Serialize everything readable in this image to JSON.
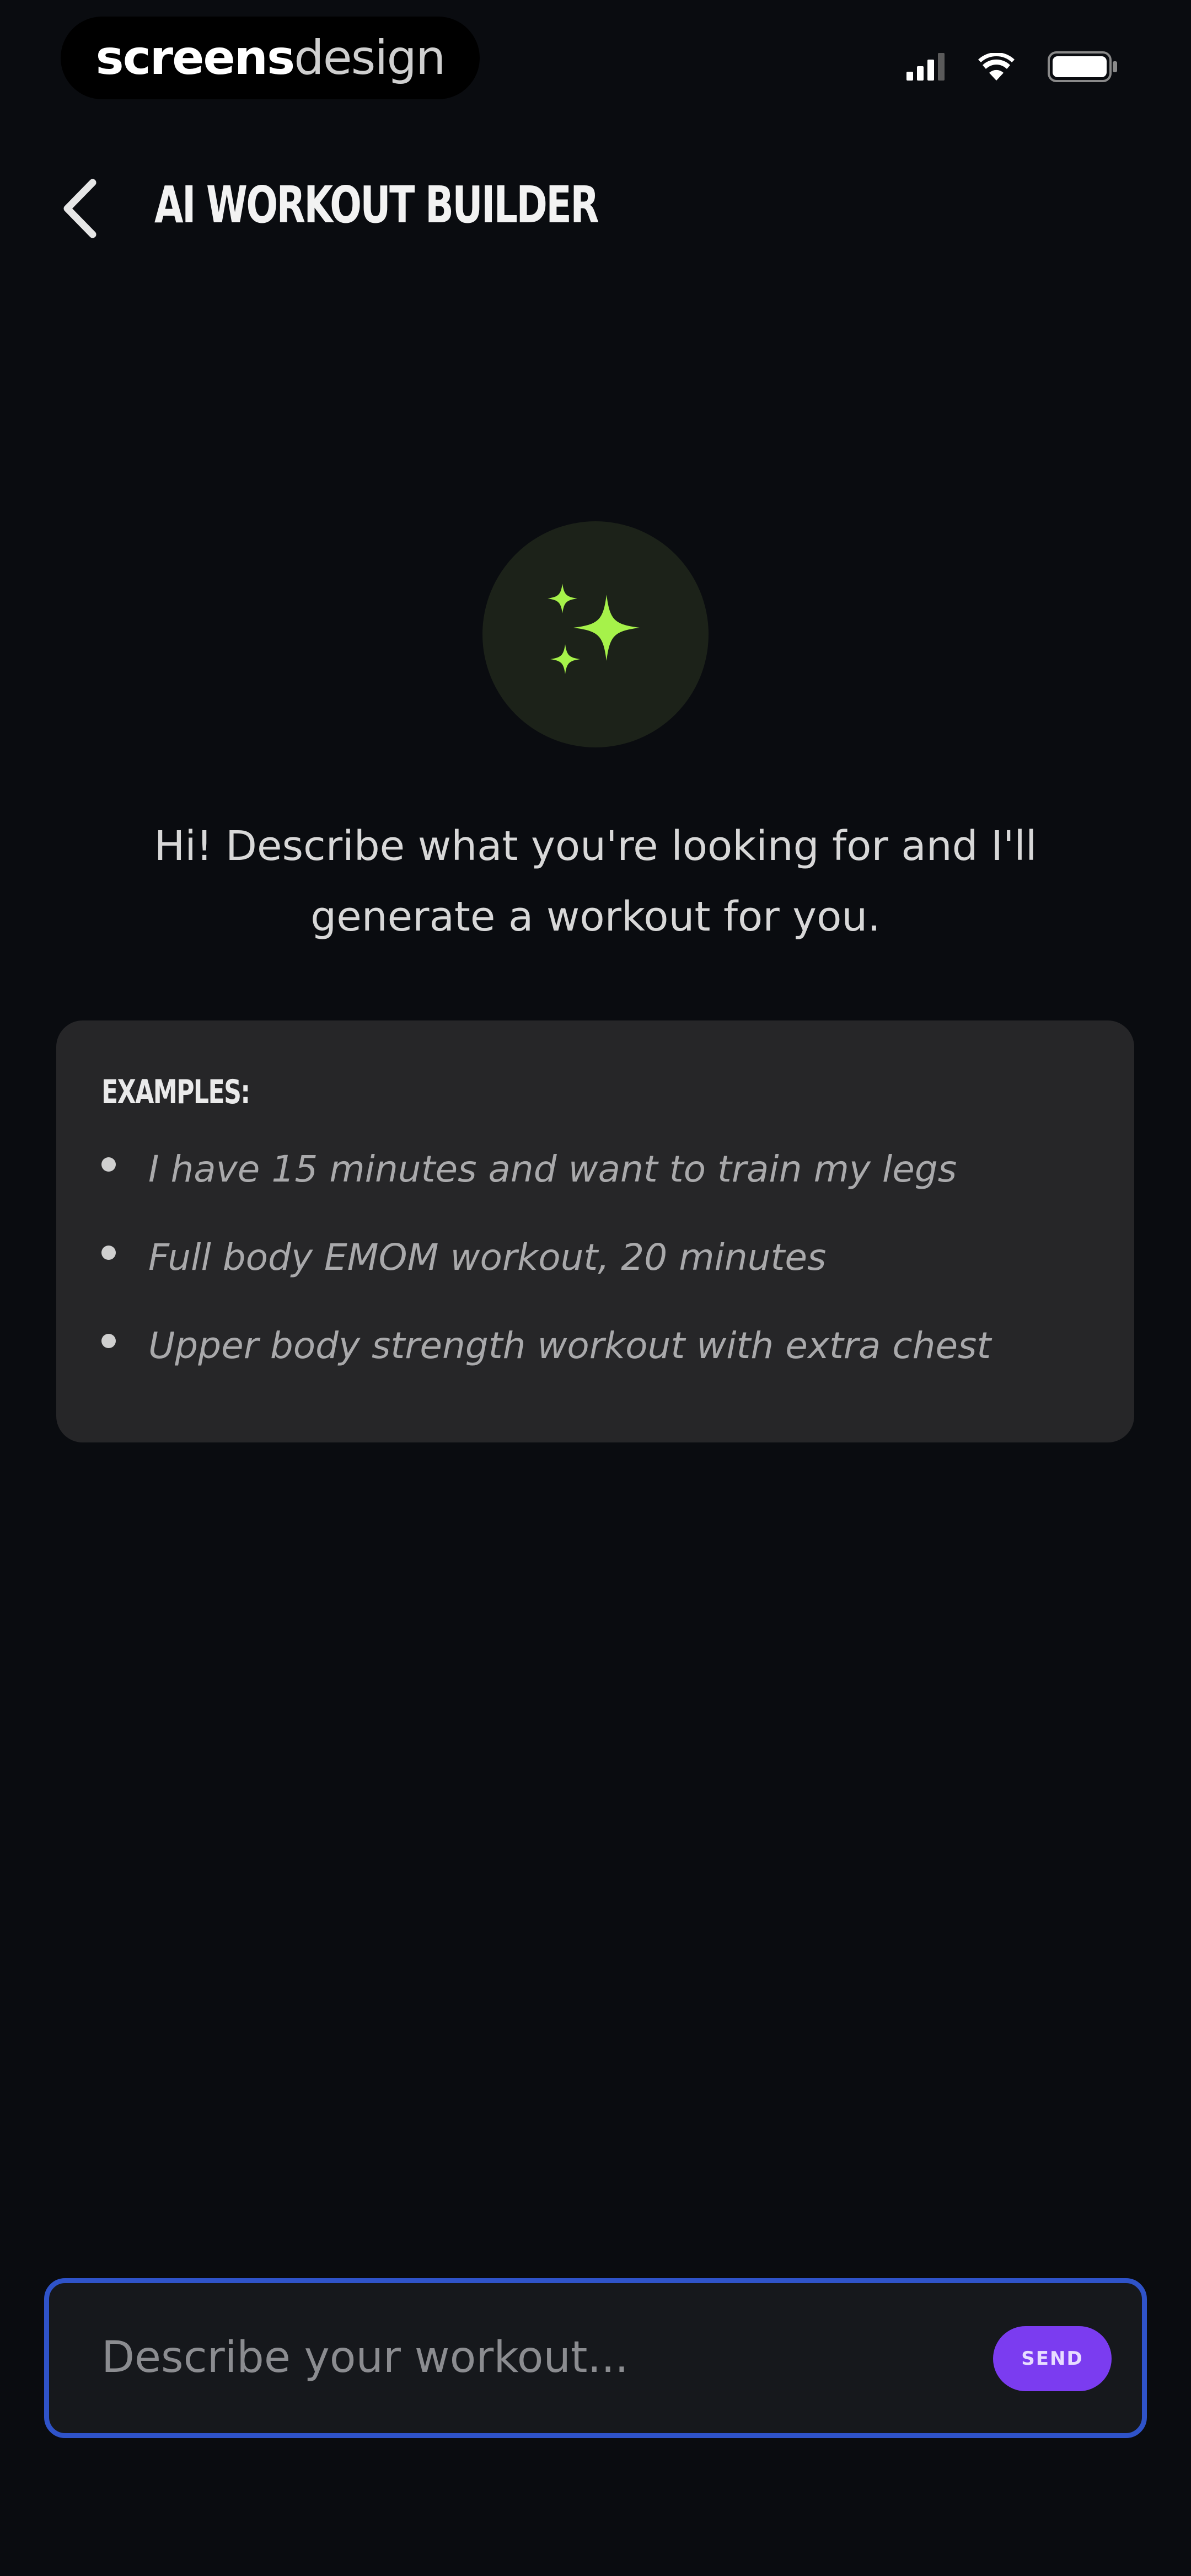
{
  "status_bar": {
    "watermark_bold": "screens",
    "watermark_light": "design",
    "icons": [
      "signal-icon",
      "wifi-icon",
      "battery-icon"
    ]
  },
  "header": {
    "back_icon": "chevron-left-icon",
    "title": "AI WORKOUT BUILDER"
  },
  "hero": {
    "icon": "sparkles-icon",
    "accent_color": "#a6f24a",
    "intro": "Hi! Describe what you're looking for and I'll generate a workout for you."
  },
  "examples": {
    "heading": "EXAMPLES:",
    "items": [
      "I have 15 minutes and want to train my legs",
      "Full body EMOM workout, 20 minutes",
      "Upper body strength workout with extra chest"
    ]
  },
  "composer": {
    "placeholder": "Describe your workout...",
    "value": "",
    "send_label": "SEND",
    "border_color": "#2f53c9",
    "send_color": "#7b3cf0"
  }
}
